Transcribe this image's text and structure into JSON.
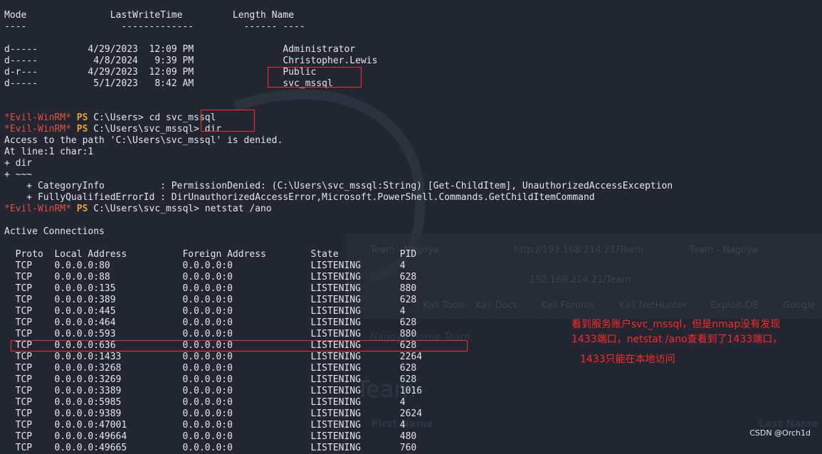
{
  "dir_header": {
    "mode": "Mode",
    "lastwrite": "LastWriteTime",
    "length": "Length",
    "name": "Name"
  },
  "dir_rows": [
    {
      "mode": "d-----",
      "date": "4/29/2023",
      "time": "12:09 PM",
      "name": "Administrator"
    },
    {
      "mode": "d-----",
      "date": "4/8/2024",
      "time": "9:39 PM",
      "name": "Christopher.Lewis"
    },
    {
      "mode": "d-r---",
      "date": "4/29/2023",
      "time": "12:09 PM",
      "name": "Public"
    },
    {
      "mode": "d-----",
      "date": "5/1/2023",
      "time": "8:42 AM",
      "name": "svc_mssql"
    }
  ],
  "prompts": [
    {
      "host": "*Evil-WinRM*",
      "ps": "PS",
      "path": "C:\\Users>",
      "cmd": "cd svc_mssql"
    },
    {
      "host": "*Evil-WinRM*",
      "ps": "PS",
      "path": "C:\\Users\\svc_mssql>",
      "cmd": "dir"
    },
    {
      "host": "*Evil-WinRM*",
      "ps": "PS",
      "path": "C:\\Users\\svc_mssql>",
      "cmd": "netstat /ano"
    }
  ],
  "error_lines": {
    "l1": "Access to the path 'C:\\Users\\svc_mssql' is denied.",
    "l2": "At line:1 char:1",
    "l3": "+ dir",
    "l4": "+ ~~~",
    "l5": "    + CategoryInfo          : PermissionDenied: (C:\\Users\\svc_mssql:String) [Get-ChildItem], UnauthorizedAccessException",
    "l6": "    + FullyQualifiedErrorId : DirUnauthorizedAccessError,Microsoft.PowerShell.Commands.GetChildItemCommand"
  },
  "netstat": {
    "title": "Active Connections",
    "headers": {
      "proto": "Proto",
      "local": "Local Address",
      "foreign": "Foreign Address",
      "state": "State",
      "pid": "PID"
    },
    "rows": [
      {
        "proto": "TCP",
        "local": "0.0.0.0:80",
        "foreign": "0.0.0.0:0",
        "state": "LISTENING",
        "pid": "4"
      },
      {
        "proto": "TCP",
        "local": "0.0.0.0:88",
        "foreign": "0.0.0.0:0",
        "state": "LISTENING",
        "pid": "628"
      },
      {
        "proto": "TCP",
        "local": "0.0.0.0:135",
        "foreign": "0.0.0.0:0",
        "state": "LISTENING",
        "pid": "880"
      },
      {
        "proto": "TCP",
        "local": "0.0.0.0:389",
        "foreign": "0.0.0.0:0",
        "state": "LISTENING",
        "pid": "628"
      },
      {
        "proto": "TCP",
        "local": "0.0.0.0:445",
        "foreign": "0.0.0.0:0",
        "state": "LISTENING",
        "pid": "4"
      },
      {
        "proto": "TCP",
        "local": "0.0.0.0:464",
        "foreign": "0.0.0.0:0",
        "state": "LISTENING",
        "pid": "628"
      },
      {
        "proto": "TCP",
        "local": "0.0.0.0:593",
        "foreign": "0.0.0.0:0",
        "state": "LISTENING",
        "pid": "880"
      },
      {
        "proto": "TCP",
        "local": "0.0.0.0:636",
        "foreign": "0.0.0.0:0",
        "state": "LISTENING",
        "pid": "628"
      },
      {
        "proto": "TCP",
        "local": "0.0.0.0:1433",
        "foreign": "0.0.0.0:0",
        "state": "LISTENING",
        "pid": "2264"
      },
      {
        "proto": "TCP",
        "local": "0.0.0.0:3268",
        "foreign": "0.0.0.0:0",
        "state": "LISTENING",
        "pid": "628"
      },
      {
        "proto": "TCP",
        "local": "0.0.0.0:3269",
        "foreign": "0.0.0.0:0",
        "state": "LISTENING",
        "pid": "628"
      },
      {
        "proto": "TCP",
        "local": "0.0.0.0:3389",
        "foreign": "0.0.0.0:0",
        "state": "LISTENING",
        "pid": "1016"
      },
      {
        "proto": "TCP",
        "local": "0.0.0.0:5985",
        "foreign": "0.0.0.0:0",
        "state": "LISTENING",
        "pid": "4"
      },
      {
        "proto": "TCP",
        "local": "0.0.0.0:9389",
        "foreign": "0.0.0.0:0",
        "state": "LISTENING",
        "pid": "2624"
      },
      {
        "proto": "TCP",
        "local": "0.0.0.0:47001",
        "foreign": "0.0.0.0:0",
        "state": "LISTENING",
        "pid": "4"
      },
      {
        "proto": "TCP",
        "local": "0.0.0.0:49664",
        "foreign": "0.0.0.0:0",
        "state": "LISTENING",
        "pid": "480"
      },
      {
        "proto": "TCP",
        "local": "0.0.0.0:49665",
        "foreign": "0.0.0.0:0",
        "state": "LISTENING",
        "pid": "760"
      }
    ]
  },
  "annotations": {
    "line1": "看到服务账户svc_mssql，但是nmap没有发现",
    "line2": "1433端口，netstat /ano查看到了1433端口，",
    "line3": "1433只能在本地访问"
  },
  "background_ghost": {
    "tab1": "Team - Nagoya",
    "tab2": "http://192.168.214.21/Team",
    "tab3": "Team - Nagoya",
    "url": "192.168.214.21/Team",
    "bookmarks": [
      "Kali Tools",
      "Kali Docs",
      "Kali Forums",
      "Kali NetHunter",
      "Exploit-DB",
      "Google"
    ],
    "breadcrumb": "Nagoya  Home  Team",
    "heading": "Team",
    "col1": "First Name",
    "col2": "Last Name"
  },
  "watermark": "CSDN @Orch1d",
  "colors": {
    "background": "#212631",
    "text": "#e4e7ec",
    "prompt": "#e3533d",
    "ps": "#f0a02c",
    "annotation": "#ff2a2a"
  }
}
